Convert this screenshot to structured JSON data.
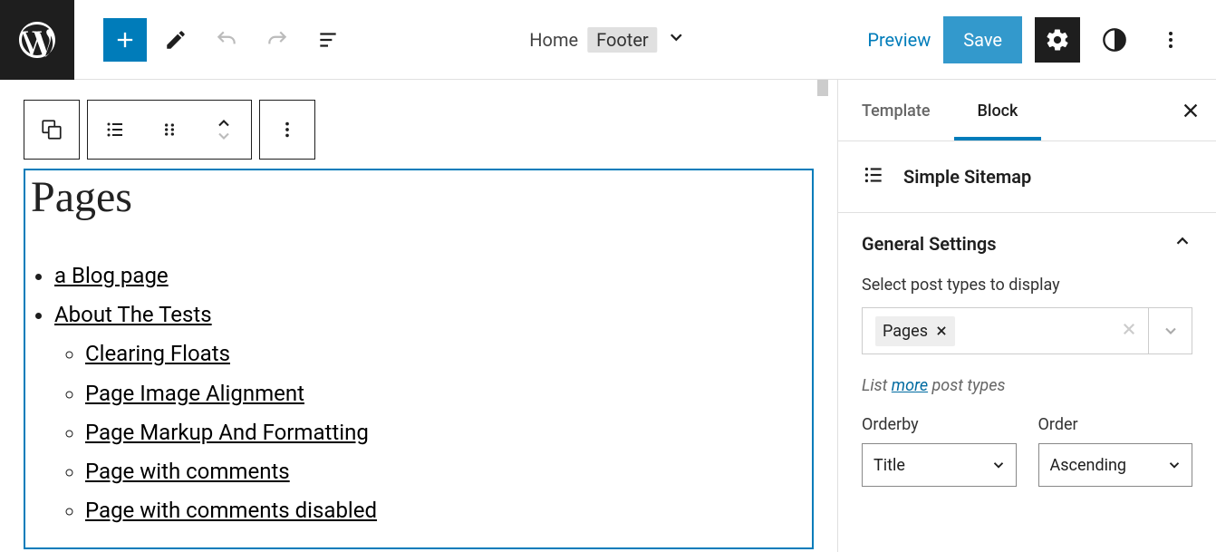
{
  "header": {
    "doc_path": "Home",
    "doc_current": "Footer",
    "preview": "Preview",
    "save": "Save"
  },
  "block": {
    "heading": "Pages",
    "items": [
      {
        "label": "a Blog page",
        "children": []
      },
      {
        "label": "About The Tests",
        "children": [
          {
            "label": "Clearing Floats"
          },
          {
            "label": "Page Image Alignment"
          },
          {
            "label": "Page Markup And Formatting"
          },
          {
            "label": "Page with comments"
          },
          {
            "label": "Page with comments disabled"
          }
        ]
      }
    ]
  },
  "sidebar": {
    "tabs": {
      "template": "Template",
      "block": "Block"
    },
    "block_name": "Simple Sitemap",
    "panel_title": "General Settings",
    "post_types_label": "Select post types to display",
    "tag_value": "Pages",
    "hint_prefix": "List ",
    "hint_link": "more",
    "hint_suffix": " post types",
    "orderby": {
      "label": "Orderby",
      "value": "Title"
    },
    "order": {
      "label": "Order",
      "value": "Ascending"
    }
  }
}
